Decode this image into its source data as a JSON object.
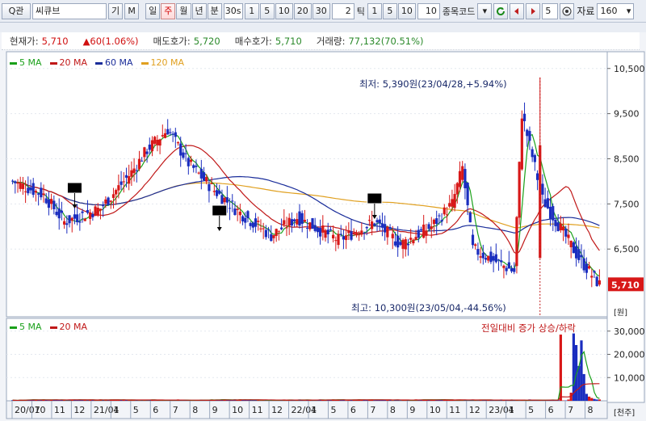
{
  "toolbar": {
    "search_btn": "Q관",
    "stock_name": "씨큐브",
    "btn_gi": "기",
    "btn_m": "M",
    "periods": [
      "일",
      "주",
      "월",
      "년",
      "분"
    ],
    "active_period": "주",
    "minute_value": "30s",
    "minute_buttons": [
      "1",
      "5",
      "10",
      "20",
      "30"
    ],
    "tick_value": "2",
    "tick_label": "틱",
    "tick_buttons": [
      "1",
      "5",
      "10"
    ],
    "tick_extra": "10",
    "code_label": "종목코드",
    "count_value": "5",
    "data_label": "자료",
    "data_count": "160"
  },
  "info": {
    "price_label": "현재가:",
    "price": "5,710",
    "change": "▲60(1.06%)",
    "ask_label": "매도호가:",
    "ask": "5,720",
    "bid_label": "매수호가:",
    "bid": "5,710",
    "volume_label": "거래량:",
    "volume": "77,132(70.51%)"
  },
  "price_legend": [
    {
      "name": "5 MA",
      "color": "#1aa01a"
    },
    {
      "name": "20 MA",
      "color": "#c01818"
    },
    {
      "name": "60 MA",
      "color": "#1a2d9a"
    },
    {
      "name": "120 MA",
      "color": "#e0a020"
    }
  ],
  "volume_legend": [
    {
      "name": "5 MA",
      "color": "#1aa01a"
    },
    {
      "name": "20 MA",
      "color": "#c01818"
    }
  ],
  "annotations": {
    "low": "최저: 5,390원(23/04/28,+5.94%)",
    "high": "최고: 10,300원(23/05/04,-44.56%)",
    "volume_note": "전일대비 증가 상승/하락"
  },
  "price_axis": {
    "ticks": [
      "10,500",
      "9,500",
      "8,500",
      "7,500",
      "6,500"
    ],
    "unit": "[원]",
    "current": "5,710"
  },
  "volume_axis": {
    "ticks": [
      "30,000",
      "20,000",
      "10,000"
    ],
    "unit": "[천주]"
  },
  "x_axis": {
    "labels": [
      "20/07",
      "10",
      "11",
      "12",
      "21/01",
      "4",
      "5",
      "6",
      "7",
      "8",
      "9",
      "10",
      "11",
      "12",
      "22/01",
      "4",
      "5",
      "6",
      "7",
      "8",
      "9",
      "10",
      "11",
      "12",
      "23/01",
      "4",
      "5",
      "6",
      "7",
      "8"
    ]
  },
  "colors": {
    "up": "#d81818",
    "down": "#1a2dbf",
    "ma5": "#1aa01a",
    "ma20": "#c01818",
    "ma60": "#1a2d9a",
    "ma120": "#e0a020"
  },
  "chart_data": [
    {
      "type": "candlestick",
      "title": "",
      "ylim": [
        5000,
        10800
      ],
      "yticks": [
        10500,
        9500,
        8500,
        7500,
        6500
      ],
      "ylabel": "[원]",
      "markers": {
        "current_price": 5710,
        "high": 10300,
        "low": 5390
      },
      "segments": [
        {
          "from": 8000,
          "to": 7700,
          "n": 12
        },
        {
          "from": 7700,
          "to": 7100,
          "n": 8
        },
        {
          "from": 7100,
          "to": 7400,
          "n": 14
        },
        {
          "from": 7400,
          "to": 8200,
          "n": 12
        },
        {
          "from": 8200,
          "to": 8700,
          "n": 6
        },
        {
          "from": 8700,
          "to": 9150,
          "n": 8
        },
        {
          "from": 9150,
          "to": 8400,
          "n": 8
        },
        {
          "from": 8400,
          "to": 7800,
          "n": 10
        },
        {
          "from": 7800,
          "to": 7300,
          "n": 10
        },
        {
          "from": 7300,
          "to": 6800,
          "n": 12
        },
        {
          "from": 6800,
          "to": 7200,
          "n": 10
        },
        {
          "from": 7200,
          "to": 6700,
          "n": 16
        },
        {
          "from": 6700,
          "to": 7100,
          "n": 14
        },
        {
          "from": 7100,
          "to": 6600,
          "n": 10
        },
        {
          "from": 6600,
          "to": 7000,
          "n": 12
        },
        {
          "from": 7000,
          "to": 7500,
          "n": 8
        },
        {
          "from": 7500,
          "to": 8300,
          "n": 4
        },
        {
          "from": 8300,
          "to": 6500,
          "n": 4
        },
        {
          "from": 6500,
          "to": 6000,
          "n": 16
        },
        {
          "from": 6000,
          "to": 9500,
          "n": 3
        },
        {
          "from": 9500,
          "to": 7600,
          "n": 8
        },
        {
          "from": 7600,
          "to": 6300,
          "n": 14
        },
        {
          "from": 6300,
          "to": 5710,
          "n": 8
        }
      ]
    },
    {
      "type": "bar",
      "title": "",
      "ylim": [
        0,
        32000
      ],
      "yticks": [
        30000,
        20000,
        10000
      ],
      "ylabel": "[천주]",
      "spikes": [
        {
          "index": 21,
          "value": 28500
        },
        {
          "index": 25,
          "value": 3500
        },
        {
          "index": 26,
          "value": 29000
        },
        {
          "index": 27,
          "value": 24000
        },
        {
          "index": 28,
          "value": 15000
        },
        {
          "index": 29,
          "value": 26000
        },
        {
          "index": 30,
          "value": 11500
        },
        {
          "index": 31,
          "value": 3000
        },
        {
          "index": 32,
          "value": 1800
        },
        {
          "index": 33,
          "value": 1200
        },
        {
          "index": 34,
          "value": 800
        }
      ],
      "base": 350
    }
  ]
}
